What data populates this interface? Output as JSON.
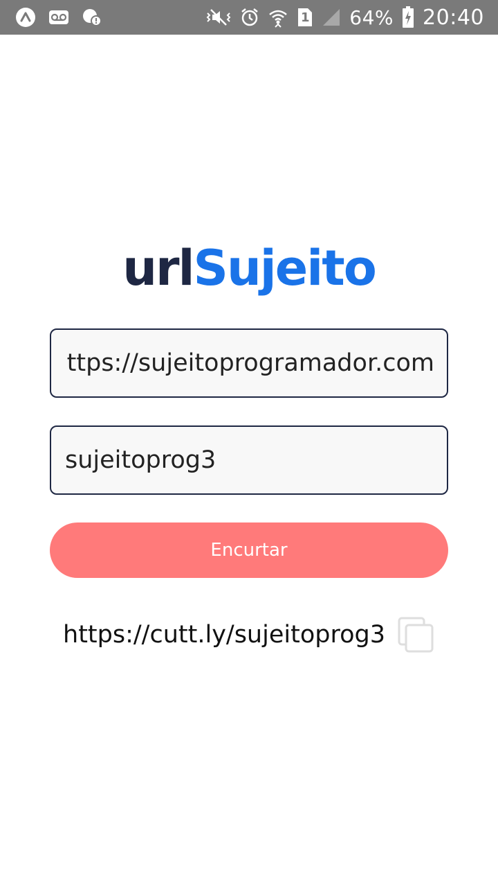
{
  "status_bar": {
    "battery_percent": "64%",
    "time": "20:40",
    "sim_slot": "1",
    "left_icons": [
      "app-a-icon",
      "voicemail-icon",
      "notification-icon"
    ],
    "right_icons": [
      "vibrate-icon",
      "alarm-icon",
      "wifi-icon",
      "sim-icon",
      "signal-icon",
      "battery-charging-icon"
    ]
  },
  "logo": {
    "part1": "url",
    "part2": "Sujeito"
  },
  "form": {
    "url_value": "https://sujeitoprogramador.com",
    "alias_value": "sujeitoprog3",
    "button_label": "Encurtar"
  },
  "result": {
    "link": "https://cutt.ly/sujeitoprog3",
    "copy_icon": "copy-icon"
  },
  "colors": {
    "status_bar": "#7a7a7a",
    "logo_dark": "#1e2743",
    "logo_accent": "#1a73e8",
    "button": "#ff7a7a",
    "field_border": "#1e2743",
    "field_bg": "#f8f8f8"
  }
}
